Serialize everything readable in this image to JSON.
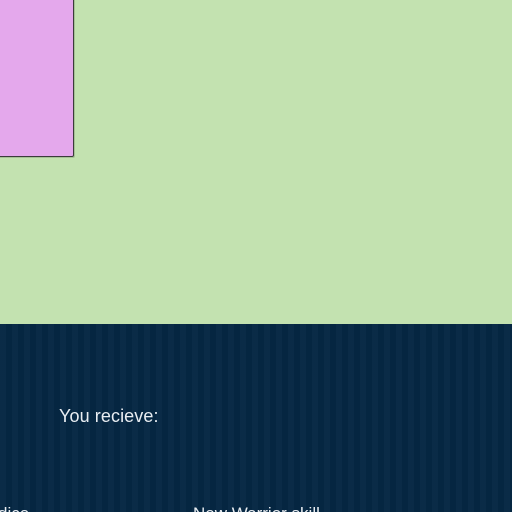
{
  "panel": {
    "heading": "You recieve:",
    "items": [
      {
        "label": "dice"
      },
      {
        "label": "New Warrior skill"
      }
    ]
  },
  "colors": {
    "background": "#c3e2b0",
    "card": "#e4a8ec",
    "panel": "#052743",
    "text": "#e8edf2"
  }
}
